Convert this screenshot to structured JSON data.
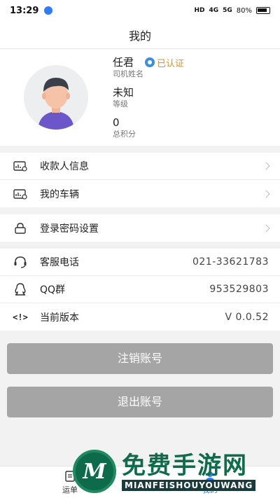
{
  "status": {
    "time": "13:29",
    "net_hd": "HD",
    "net_4g": "4G",
    "net_5g": "5G",
    "battery": "80%"
  },
  "nav": {
    "title": "我的"
  },
  "profile": {
    "name": "任君",
    "name_label": "司机姓名",
    "verified": "已认证",
    "level": "未知",
    "level_label": "等级",
    "points": "0",
    "points_label": "总积分"
  },
  "group1": [
    {
      "label": "收款人信息",
      "icon": "payee-card-icon"
    },
    {
      "label": "我的车辆",
      "icon": "vehicle-card-icon"
    }
  ],
  "group2": [
    {
      "label": "登录密码设置",
      "icon": "lock-icon"
    }
  ],
  "group3": [
    {
      "label": "客服电话",
      "value": "021-33621783",
      "icon": "headset-icon"
    },
    {
      "label": "QQ群",
      "value": "953529803",
      "icon": "qq-icon"
    },
    {
      "label": "当前版本",
      "value": "V 0.0.52",
      "icon": "code-icon"
    }
  ],
  "buttons": {
    "cancel_account": "注销账号",
    "logout": "退出账号"
  },
  "tabs": [
    {
      "label": "运单",
      "icon": "waybill-icon"
    },
    {
      "label": "我的",
      "icon": "profile-icon"
    }
  ],
  "watermark": {
    "cn": "免费手游网",
    "en": "MIANFEISHOUYOUWANG",
    "logo": "M"
  },
  "colors": {
    "accent": "#2f7cf6",
    "button": "#a5a5a5",
    "verified": "#c8963c"
  }
}
